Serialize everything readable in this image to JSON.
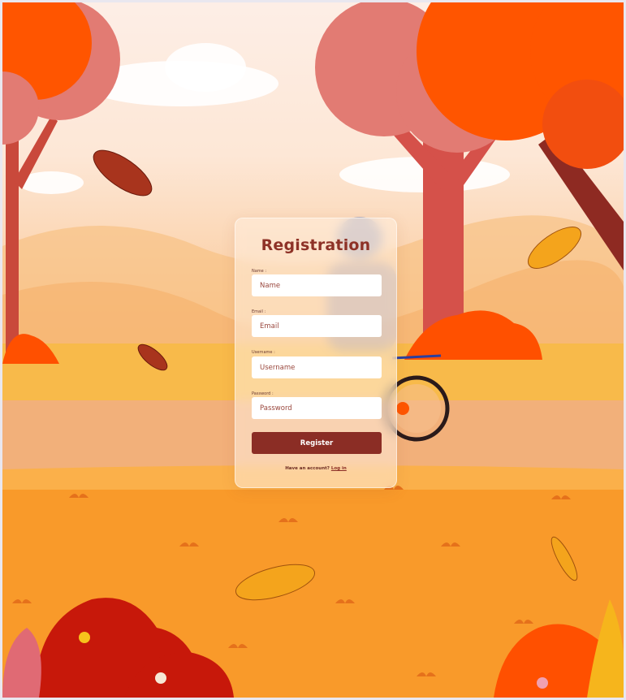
{
  "form": {
    "title": "Registration",
    "fields": [
      {
        "label": "Name :",
        "placeholder": "Name"
      },
      {
        "label": "Email :",
        "placeholder": "Email"
      },
      {
        "label": "Username :",
        "placeholder": "Username"
      },
      {
        "label": "Password :",
        "placeholder": "Password"
      }
    ],
    "submit_label": "Register",
    "footer_text": "Have an account?",
    "footer_link": "Log in"
  },
  "colors": {
    "accent": "#8b2d25",
    "title": "#8e3227",
    "background_warm": "#f89a2e"
  },
  "icons": {
    "scene": "autumn-park-illustration"
  }
}
